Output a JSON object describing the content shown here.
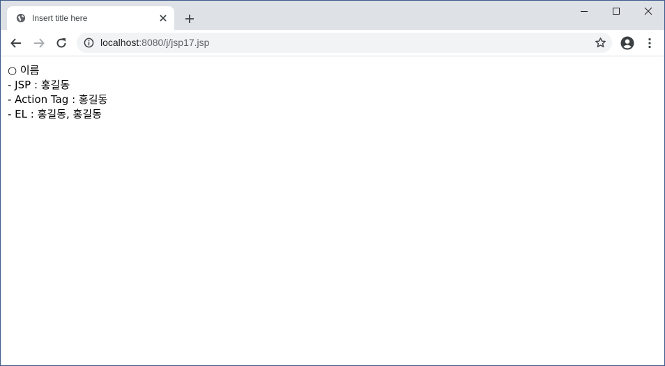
{
  "browser": {
    "tab_title": "Insert title here",
    "url_host": "localhost",
    "url_rest": ":8080/j/jsp17.jsp"
  },
  "icons": {
    "favicon": "globe-icon",
    "tab_close": "close-icon",
    "new_tab": "plus-icon",
    "minimize": "minimize-icon",
    "maximize": "maximize-icon",
    "close_window": "close-icon",
    "back": "arrow-left-icon",
    "forward": "arrow-right-icon",
    "reload": "reload-icon",
    "site_info": "info-icon",
    "bookmark": "star-icon",
    "profile": "account-icon",
    "menu": "kebab-menu-icon"
  },
  "colors": {
    "tabstrip_bg": "#dee1e6",
    "omnibox_bg": "#f1f3f4",
    "window_border": "#3c5a8a"
  },
  "content": {
    "lines": [
      "○ 이름",
      "- JSP : 홍길동",
      "- Action Tag : 홍길동",
      "- EL : 홍길동, 홍길동"
    ]
  }
}
